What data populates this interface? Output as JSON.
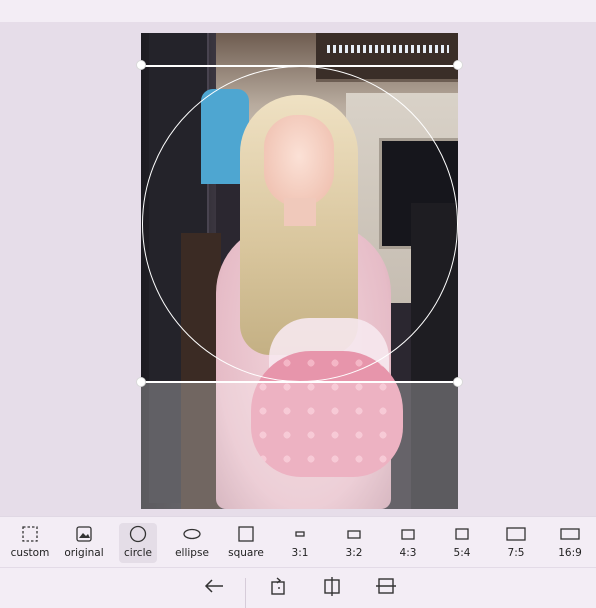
{
  "crop_tools": [
    {
      "id": "custom",
      "label": "custom",
      "icon": "dashed-square-icon",
      "selected": false
    },
    {
      "id": "original",
      "label": "original",
      "icon": "image-icon",
      "selected": false
    },
    {
      "id": "circle",
      "label": "circle",
      "icon": "circle-icon",
      "selected": true
    },
    {
      "id": "ellipse",
      "label": "ellipse",
      "icon": "ellipse-icon",
      "selected": false
    },
    {
      "id": "square",
      "label": "square",
      "icon": "square-icon",
      "selected": false
    },
    {
      "id": "3-1",
      "label": "3:1",
      "icon": "ratio-3-1-icon",
      "selected": false
    },
    {
      "id": "3-2",
      "label": "3:2",
      "icon": "ratio-3-2-icon",
      "selected": false
    },
    {
      "id": "4-3",
      "label": "4:3",
      "icon": "ratio-4-3-icon",
      "selected": false
    },
    {
      "id": "5-4",
      "label": "5:4",
      "icon": "ratio-5-4-icon",
      "selected": false
    },
    {
      "id": "7-5",
      "label": "7:5",
      "icon": "ratio-7-5-icon",
      "selected": false
    },
    {
      "id": "16-9",
      "label": "16:9",
      "icon": "ratio-16-9-icon",
      "selected": false
    }
  ],
  "bottom_actions": [
    "back-arrow-icon",
    "rotate-icon",
    "flip-horizontal-icon",
    "flip-vertical-icon"
  ],
  "colors": {
    "accent_bg": "#f3edf5",
    "canvas_bg": "#e6dde9",
    "selected_tool_bg": "#e4dde7",
    "crop_frame": "#ffffff"
  }
}
